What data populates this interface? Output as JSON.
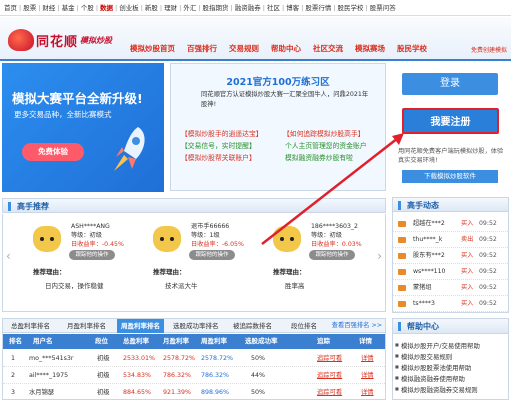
{
  "topnav": [
    "首页",
    "股票",
    "财经",
    "基金",
    "个股",
    "数据",
    "创业板",
    "新股",
    "理财",
    "外汇",
    "股指期货",
    "融资融券",
    "社区",
    "博客",
    "股票行情",
    "股民学校",
    "股票问答"
  ],
  "topnav_hot_index": 5,
  "header": {
    "brand": "同花顺",
    "subbrand": "模拟炒股",
    "nav": [
      "模拟炒股首页",
      "百强排行",
      "交易规则",
      "帮助中心",
      "社区交流",
      "模拟赛场",
      "股民学校"
    ],
    "note": "免费创建模拟"
  },
  "banner": {
    "title": "模拟大赛平台全新升级!",
    "subtitle": "更多交易品种，全新比赛模式",
    "button": "免费体验"
  },
  "announce": {
    "title": "2021官方100万练习区",
    "desc": "同花顺官方认证模拟炒股大赛一汇聚全国牛人，问鼎2021年股神!",
    "features": [
      {
        "text": "【模拟炒股手的逍遥达宝】",
        "color": "red"
      },
      {
        "text": "【如何追踪模拟炒股高手】",
        "color": "red"
      },
      {
        "text": "【交易信号，实时提醒】",
        "color": "green"
      },
      {
        "text": "个人主页管理您的资金账户",
        "color": "green"
      },
      {
        "text": "【模拟炒股帮关联账户】",
        "color": "red"
      },
      {
        "text": "模拟融资融券炒股有啦",
        "color": "green"
      }
    ]
  },
  "login": {
    "login_label": "登录",
    "register_label": "我要注册",
    "note": "用同花顺免费客户端玩模拟炒股，体验真实交易环境!",
    "download_label": "下载模拟炒股软件"
  },
  "experts": {
    "title": "高手推荐",
    "cards": [
      {
        "name": "ASH****ANG",
        "level": "等级：初级",
        "rate": "日收益率：-0.45%",
        "track": "跟踪他的操作",
        "reason_label": "推荐理由：",
        "reason": "日内交易，操作稳健"
      },
      {
        "name": "退市手66666",
        "level": "等级：1级",
        "rate": "日收益率：-6.05%",
        "track": "跟踪他的操作",
        "reason_label": "推荐理由：",
        "reason": "技术派大牛"
      },
      {
        "name": "186****3603_2",
        "level": "等级：初级",
        "rate": "日收益率：0.03%",
        "track": "跟踪他的操作",
        "reason_label": "推荐理由：",
        "reason": "胜率高"
      }
    ]
  },
  "dynamics": {
    "title": "高手动态",
    "rows": [
      {
        "name": "超越在***2",
        "action": "买入",
        "time": "09:52"
      },
      {
        "name": "thu****_k",
        "action": "卖出",
        "time": "09:52"
      },
      {
        "name": "股东有***2",
        "action": "买入",
        "time": "09:52"
      },
      {
        "name": "ws****110",
        "action": "买入",
        "time": "09:52"
      },
      {
        "name": "蒙猪组",
        "action": "买入",
        "time": "09:52"
      },
      {
        "name": "ts****3",
        "action": "买入",
        "time": "09:52"
      }
    ]
  },
  "ranking": {
    "tabs": [
      "总盈利率排名",
      "月盈利率排名",
      "周盈利率排名",
      "选股成功率排名",
      "被追踪数排名",
      "段位排名"
    ],
    "active_tab": 2,
    "more": "查看百强排名 >>",
    "columns": [
      "排名",
      "用户名",
      "段位",
      "总盈利率",
      "月盈利率",
      "周盈利率",
      "选股成功率",
      "追踪",
      "详情"
    ],
    "rows": [
      [
        "1",
        "mo_***541s3r",
        "初级",
        "2533.01%",
        "2578.72%",
        "2578.72%",
        "50%",
        "追踪可看",
        "详情"
      ],
      [
        "2",
        "ail****_1975",
        "初级",
        "534.83%",
        "786.32%",
        "786.32%",
        "44%",
        "追踪可看",
        "详情"
      ],
      [
        "3",
        "水月锦瑟",
        "初级",
        "884.65%",
        "921.39%",
        "898.96%",
        "50%",
        "追踪可看",
        "详情"
      ]
    ]
  },
  "help": {
    "title": "帮助中心",
    "items": [
      "模拟炒股开户/交易使用帮助",
      "模拟炒股交易规则",
      "模拟炒股股票池使用帮助",
      "模拟融资融券使用帮助",
      "模拟炒股融资融券交易规则"
    ]
  },
  "colors": {
    "brand_red": "#c8102e",
    "accent_blue": "#3b8ee0",
    "register_border": "#e0202a"
  }
}
